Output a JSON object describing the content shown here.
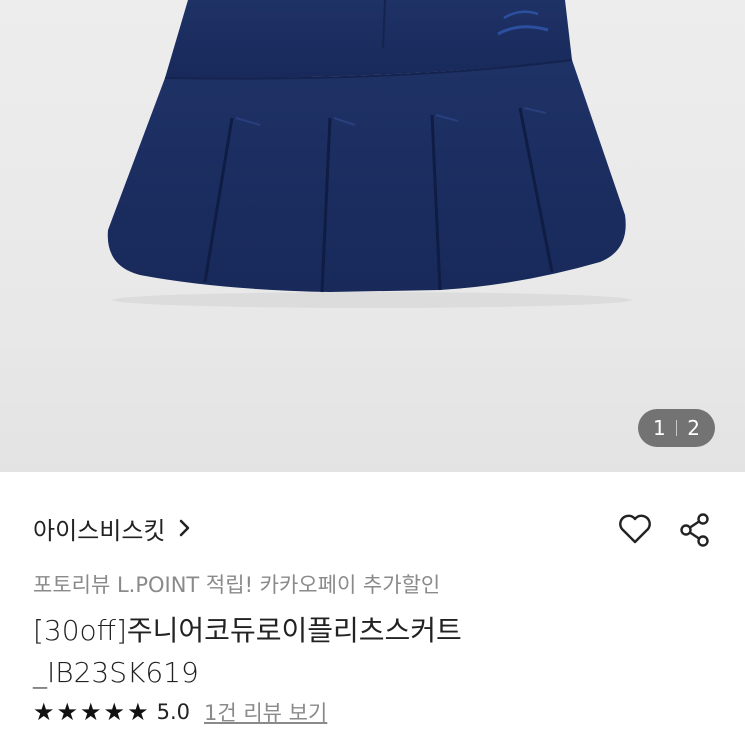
{
  "gallery": {
    "current_page": "1",
    "total_pages": "2",
    "image_subject": "navy pleated corduroy skirt"
  },
  "product": {
    "brand": "아이스비스킷",
    "promo": "포토리뷰 L.POINT 적립! 카카오페이 추가할인",
    "title_line1": "[30off]주니어코듀로이플리츠스커트",
    "title_line2": "_IB23SK619",
    "rating": "5.0",
    "rating_stars": 5,
    "review_link": "1건 리뷰 보기"
  },
  "icons": {
    "brand_chevron": "chevron-right-icon",
    "wishlist": "heart-icon",
    "share": "share-icon",
    "star": "star-icon"
  },
  "colors": {
    "skirt": "#1b2e5e",
    "page_pill": "#737373",
    "muted_text": "#8a8a8a"
  }
}
